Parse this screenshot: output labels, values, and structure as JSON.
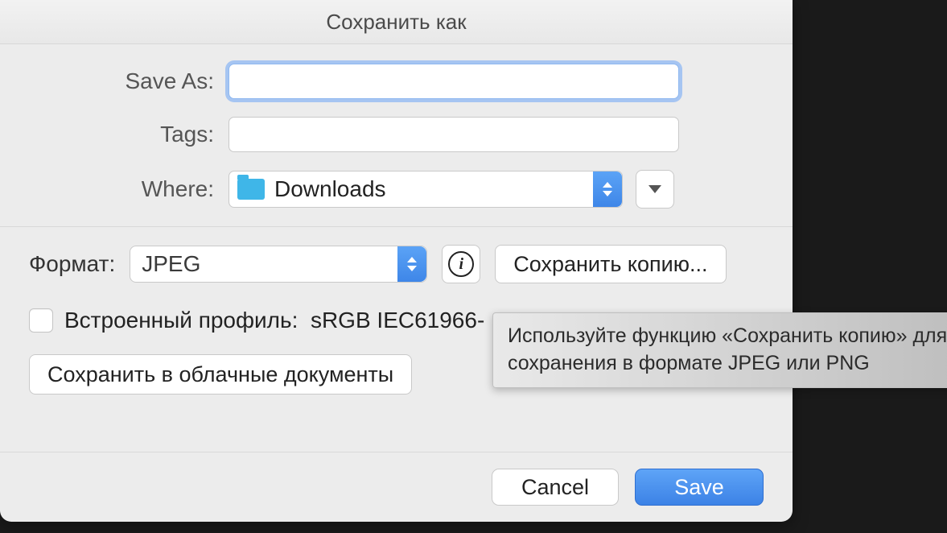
{
  "dialog": {
    "title": "Сохранить как",
    "save_as_label": "Save As:",
    "save_as_value": "",
    "tags_label": "Tags:",
    "tags_value": "",
    "where_label": "Where:",
    "where_value": "Downloads"
  },
  "format": {
    "label": "Формат:",
    "value": "JPEG",
    "save_copy_label": "Сохранить копию..."
  },
  "profile": {
    "label_prefix": "Встроенный профиль:",
    "value": "sRGB IEC61966-",
    "checked": false
  },
  "cloud": {
    "label": "Сохранить в облачные документы"
  },
  "footer": {
    "cancel": "Cancel",
    "save": "Save"
  },
  "tooltip": {
    "text": "Используйте функцию «Сохранить копию» для сохранения в формате JPEG или PNG"
  }
}
